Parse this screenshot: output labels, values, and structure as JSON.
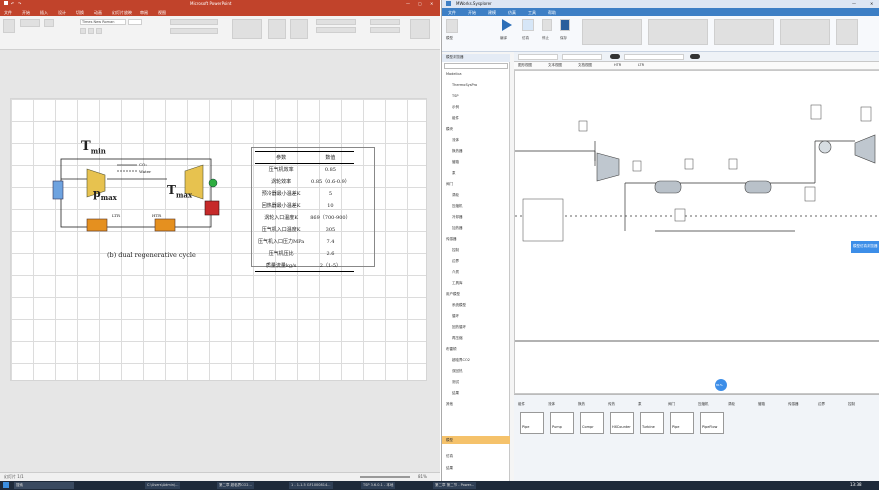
{
  "ppt": {
    "title": "Microsoft PowerPoint",
    "menu_tabs": [
      "文件",
      "开始",
      "插入",
      "设计",
      "切换",
      "动画",
      "幻灯片放映",
      "审阅",
      "视图"
    ],
    "font_name": "Times New Roman",
    "slide": {
      "caption": "(b) dual regenerative cycle",
      "legend_co2": "CO₂",
      "legend_water": "Water",
      "label_tmin_T": "T",
      "label_tmin_sub": "min",
      "label_pmax_P": "p",
      "label_pmax_sub": "max",
      "label_tmax_T": "T",
      "label_tmax_sub": "max",
      "label_ltr": "LTR",
      "label_htr": "HTR",
      "table": {
        "headers": [
          "参数",
          "数值"
        ],
        "rows": [
          [
            "压气机效率",
            "0.85"
          ],
          [
            "涡轮效率",
            "0.85（0.6-0.9）"
          ],
          [
            "预冷器最小温差K",
            "5"
          ],
          [
            "回热器最小温差K",
            "10"
          ],
          [
            "涡轮入口温度K",
            "869（700-900）"
          ],
          [
            "压气机入口温度K",
            "305"
          ],
          [
            "压气机入口压力MPa",
            "7.4"
          ],
          [
            "压气机压比",
            "2.6"
          ],
          [
            "质量流量kg/s",
            "2（1-5）"
          ]
        ]
      }
    },
    "status_left": "幻灯片 1/1",
    "zoom": "81%"
  },
  "app": {
    "title": "MWorks.Sysplorer",
    "ribbon_tabs": [
      "文件",
      "开始",
      "建模",
      "仿真",
      "工具",
      "帮助"
    ],
    "toolbar_labels": [
      "模型",
      "编译",
      "仿真",
      "停止",
      "保存"
    ],
    "tree_header": "模型浏览器",
    "tree_items": [
      "Modelica",
      "ThermoSysPro",
      "TSP",
      "示例",
      "组件",
      "模块",
      "流体",
      "换热器",
      "管路",
      "泵",
      "阀门",
      "涡轮",
      "压缩机",
      "冷却器",
      "加热器",
      "传感器",
      "控制",
      "边界",
      "介质",
      "工具库",
      "用户模型",
      "系统模型",
      "循环",
      "回热循环",
      "再压缩",
      "布雷顿",
      "超临界CO2",
      "双回热",
      "测试",
      "结果",
      "其他"
    ],
    "editor_tabs": [
      "图形视图",
      "文本视图",
      "文档视图",
      "HTR",
      "LTR"
    ],
    "palette_tabs": [
      "组件",
      "流体",
      "换热",
      "传热",
      "泵",
      "阀门",
      "压缩机",
      "涡轮",
      "管路",
      "传感器",
      "边界",
      "控制"
    ],
    "palette_items": [
      "Pipe",
      "Pump",
      "Compr",
      "HXCounter",
      "Turbine",
      "Pipe",
      "PipeFlow"
    ],
    "side_button": "模型仿真浏览器",
    "float_badge": "81%",
    "bottom_panel": [
      "模型",
      "仿真",
      "结果"
    ]
  },
  "taskbar": {
    "search": "搜索",
    "tasks": [
      "C:\\Users\\Admin\\...",
      "第二章 超临界CO2...",
      "1 - 1-1.5 GF1000814...",
      "TSP 3.6.0.1 - 本地",
      "第二章 第二节 - Power..."
    ],
    "time": "13:38"
  }
}
